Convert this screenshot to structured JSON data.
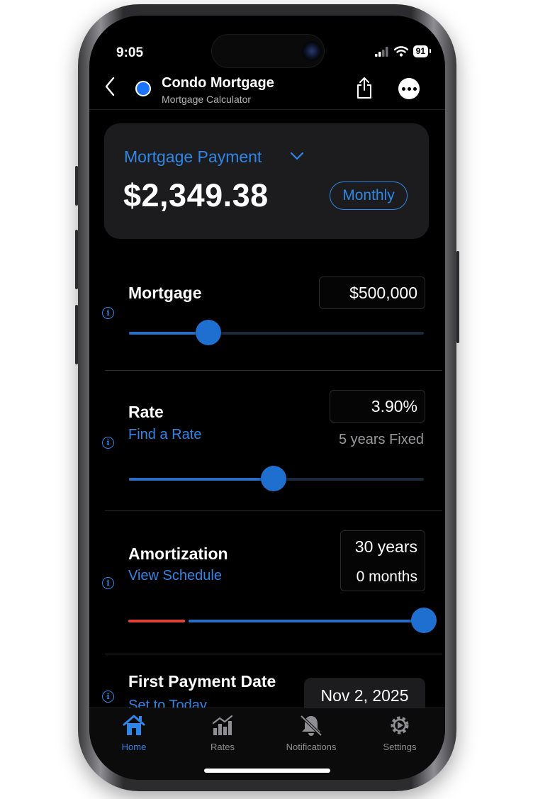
{
  "status": {
    "time": "9:05",
    "battery": "91"
  },
  "nav": {
    "title": "Condo Mortgage",
    "subtitle": "Mortgage Calculator"
  },
  "summary": {
    "label": "Mortgage Payment",
    "amount": "$2,349.38",
    "frequency": "Monthly"
  },
  "mortgage": {
    "label": "Mortgage",
    "value": "$500,000",
    "slider_fraction": 0.27
  },
  "rate": {
    "label": "Rate",
    "link": "Find a Rate",
    "value": "3.90%",
    "term": "5 years Fixed",
    "slider_fraction": 0.49
  },
  "amortization": {
    "label": "Amortization",
    "link": "View Schedule",
    "years": "30 years",
    "months": "0 months",
    "slider_fraction": 1.0
  },
  "first_payment": {
    "label": "First Payment Date",
    "link": "Set to Today",
    "value": "Nov 2, 2025"
  },
  "tabs": [
    {
      "label": "Home",
      "icon": "house-icon",
      "active": true
    },
    {
      "label": "Rates",
      "icon": "chart-icon",
      "active": false
    },
    {
      "label": "Notifications",
      "icon": "bell-icon",
      "active": false
    },
    {
      "label": "Settings",
      "icon": "gear-icon",
      "active": false
    }
  ],
  "colors": {
    "accent": "#2f86e6",
    "slider_thumb": "#1f6fd0",
    "warning_segment": "#e0403a"
  }
}
